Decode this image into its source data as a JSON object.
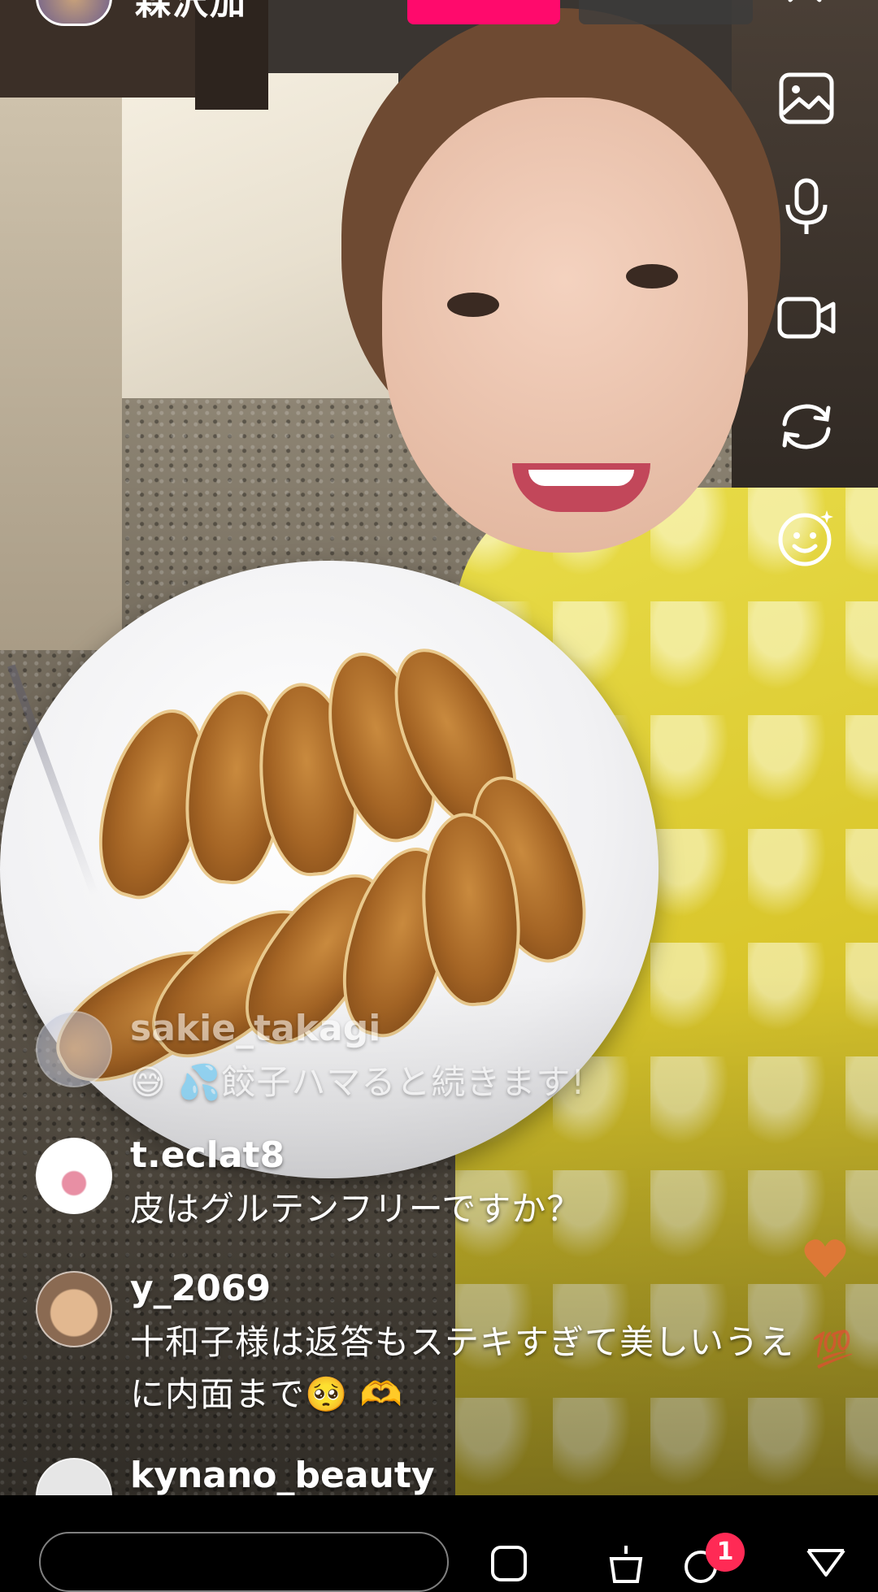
{
  "header": {
    "username": "森沢加",
    "avatar_icon": "profile-avatar"
  },
  "side_controls": [
    {
      "name": "gallery-icon"
    },
    {
      "name": "microphone-icon"
    },
    {
      "name": "video-camera-icon"
    },
    {
      "name": "flip-camera-icon"
    },
    {
      "name": "effects-smiley-icon"
    }
  ],
  "comments": [
    {
      "username": "sakie_takagi",
      "text": "😅 💦餃子ハマると続きます!",
      "faded": true
    },
    {
      "username": "t.eclat8",
      "text": "皮はグルテンフリーですか？",
      "faded": false
    },
    {
      "username": "y_2069",
      "text": "十和子様は返答もステキすぎて美しいうえに内面まで🥺 🫶",
      "faded": false
    },
    {
      "username": "kynano_beauty",
      "text": "",
      "faded": false
    }
  ],
  "reactions": {
    "heart_icon": "orange-heart",
    "hundred": "💯"
  },
  "bottom_bar": {
    "notification_count": "1"
  },
  "colors": {
    "live_badge": "#ff0a6c",
    "notification": "#ff2a55"
  }
}
